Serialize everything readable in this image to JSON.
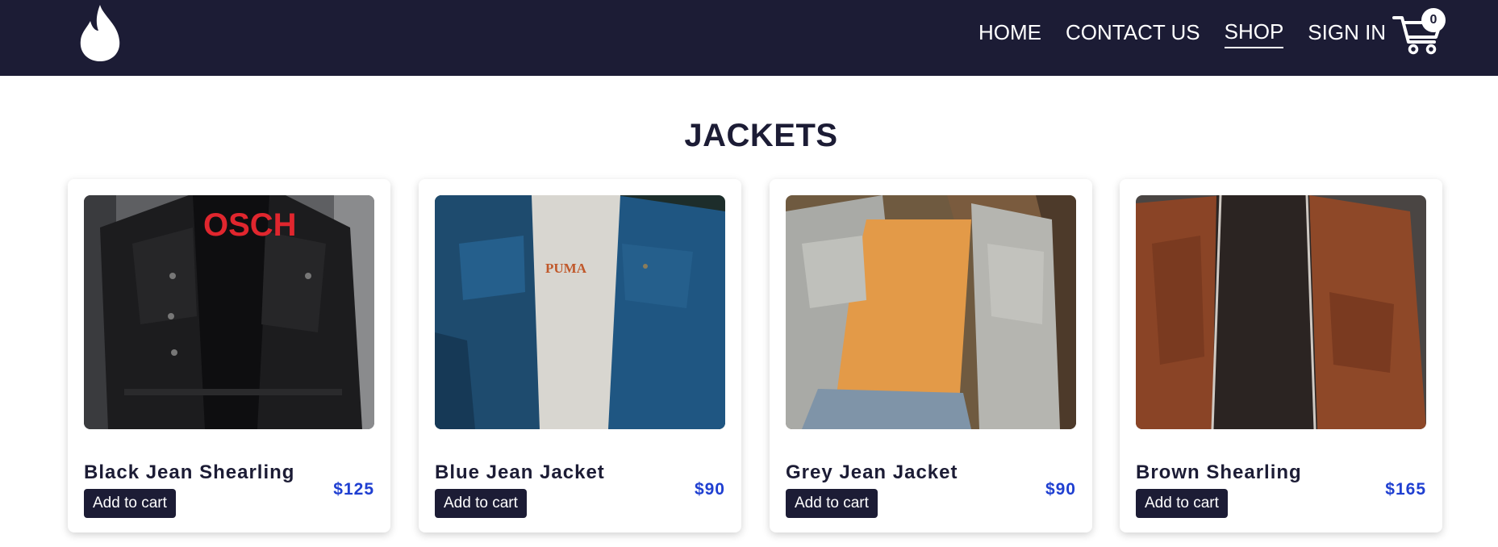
{
  "nav": {
    "links": [
      {
        "label": "HOME"
      },
      {
        "label": "CONTACT US"
      },
      {
        "label": "SHOP"
      },
      {
        "label": "SIGN IN"
      }
    ],
    "active": "SHOP",
    "cart_count": "0"
  },
  "page": {
    "title": "JACKETS"
  },
  "products": [
    {
      "name": "Black Jean Shearling",
      "price": "$125",
      "button": "Add to cart",
      "image_label": "OSCH"
    },
    {
      "name": "Blue Jean Jacket",
      "price": "$90",
      "button": "Add to cart",
      "image_label": "PUMA"
    },
    {
      "name": "Grey Jean Jacket",
      "price": "$90",
      "button": "Add to cart",
      "image_label": ""
    },
    {
      "name": "Brown Shearling",
      "price": "$165",
      "button": "Add to cart",
      "image_label": ""
    }
  ],
  "colors": {
    "navbar": "#1c1c35",
    "price": "#1f3fd1",
    "button": "#1c1c35"
  }
}
